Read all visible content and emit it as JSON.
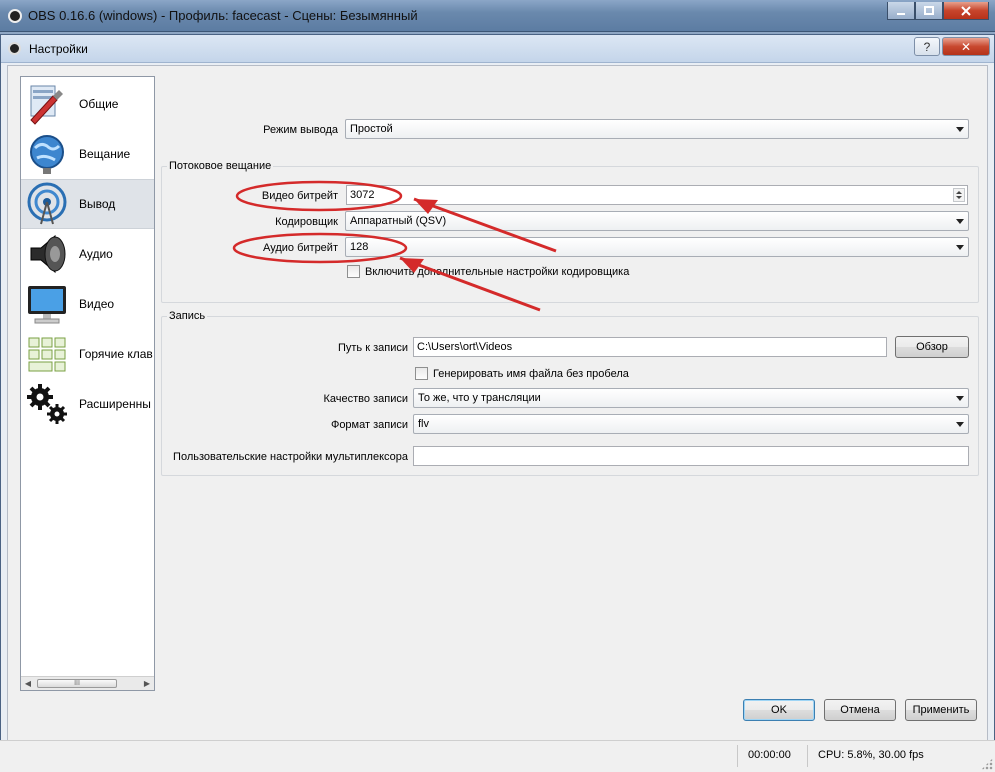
{
  "outer_window": {
    "title": "OBS 0.16.6 (windows) - Профиль: facecast - Сцены: Безымянный",
    "controls": [
      "minimize",
      "maximize",
      "close"
    ]
  },
  "dialog": {
    "title": "Настройки",
    "help_symbol": "?",
    "close_symbol": "✕"
  },
  "sidebar": {
    "items": [
      {
        "label": "Общие",
        "icon": "general-settings-icon"
      },
      {
        "label": "Вещание",
        "icon": "globe-broadcast-icon"
      },
      {
        "label": "Вывод",
        "icon": "output-antenna-icon",
        "selected": true
      },
      {
        "label": "Аудио",
        "icon": "speaker-icon"
      },
      {
        "label": "Видео",
        "icon": "monitor-icon"
      },
      {
        "label": "Горячие клав",
        "icon": "hotkeys-icon"
      },
      {
        "label": "Расширенны",
        "icon": "gears-icon"
      }
    ],
    "scroll_thumb_glyph": "III"
  },
  "output": {
    "mode_label": "Режим вывода",
    "mode_value": "Простой"
  },
  "streaming": {
    "group_title": "Потоковое вещание",
    "video_bitrate_label": "Видео битрейт",
    "video_bitrate_value": "3072",
    "encoder_label": "Кодировщик",
    "encoder_value": "Аппаратный (QSV)",
    "audio_bitrate_label": "Аудио битрейт",
    "audio_bitrate_value": "128",
    "advanced_label": "Включить дополнительные настройки кодировщика",
    "advanced_checked": false
  },
  "recording": {
    "group_title": "Запись",
    "path_label": "Путь к записи",
    "path_value": "C:\\Users\\ort\\Videos",
    "browse_label": "Обзор",
    "no_space_label": "Генерировать имя файла без пробела",
    "no_space_checked": false,
    "quality_label": "Качество записи",
    "quality_value": "То же, что у трансляции",
    "format_label": "Формат записи",
    "format_value": "flv",
    "muxer_label": "Пользовательские настройки мультиплексора",
    "muxer_value": ""
  },
  "buttons": {
    "ok": "OK",
    "cancel": "Отмена",
    "apply": "Применить"
  },
  "statusbar": {
    "time": "00:00:00",
    "cpu": "CPU: 5.8%, 30.00 fps"
  },
  "colors": {
    "annotation_red": "#d42a2a",
    "selected_item": "#dfe3e8"
  }
}
